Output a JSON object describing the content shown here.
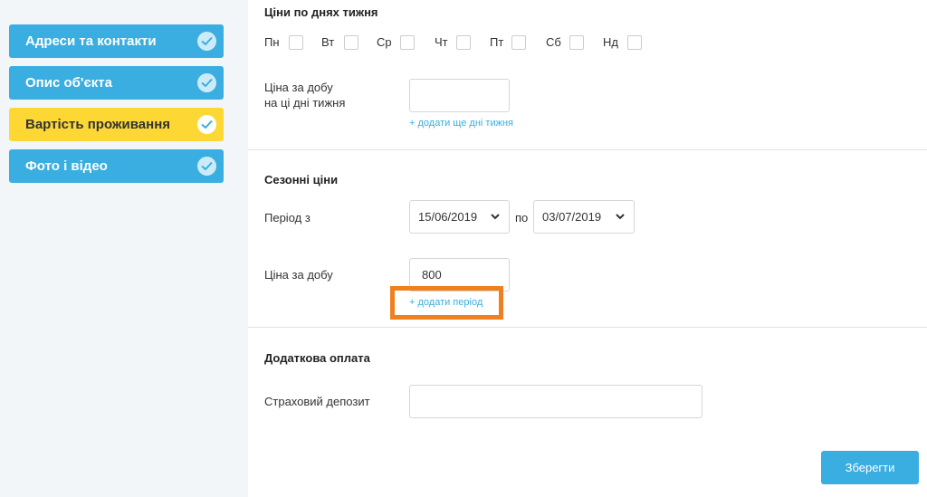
{
  "sidebar": {
    "items": [
      {
        "label": "Адреси та контакти",
        "active": false
      },
      {
        "label": "Опис об'єкта",
        "active": false
      },
      {
        "label": "Вартість проживання",
        "active": true
      },
      {
        "label": "Фото і відео",
        "active": false
      }
    ]
  },
  "weekdays": {
    "title": "Ціни по днях тижня",
    "days": [
      "Пн",
      "Вт",
      "Ср",
      "Чт",
      "Пт",
      "Сб",
      "Нд"
    ],
    "price_label_line1": "Ціна за добу",
    "price_label_line2": "на ці дні тижня",
    "price_value": "",
    "add_days_link": "+ додати ще дні тижня"
  },
  "seasonal": {
    "title": "Сезонні ціни",
    "period_label": "Період з",
    "date_from": "15/06/2019",
    "to_label": "по",
    "date_to": "03/07/2019",
    "price_label": "Ціна за добу",
    "price_value": "800",
    "add_period_link": "+ додати період"
  },
  "extra": {
    "title": "Додаткова оплата",
    "deposit_label": "Страховий депозит",
    "deposit_value": ""
  },
  "actions": {
    "save_label": "Зберегти"
  },
  "colors": {
    "accent": "#3aaee0",
    "active": "#fdd835",
    "highlight": "#f07f1e"
  }
}
